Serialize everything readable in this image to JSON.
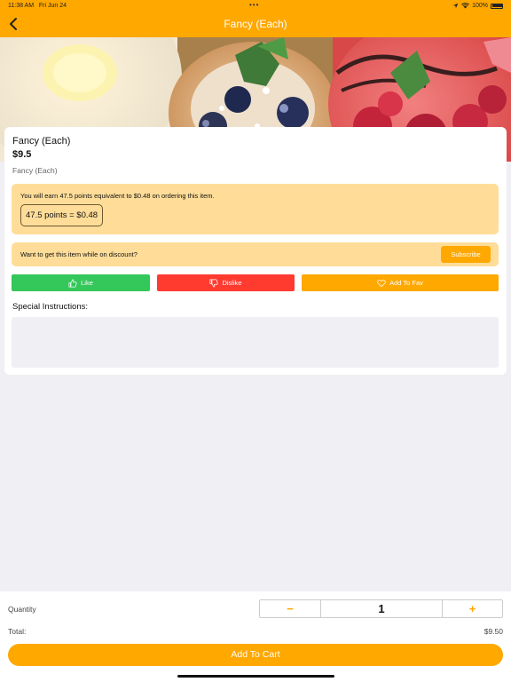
{
  "status_bar": {
    "time": "11:38 AM",
    "date": "Fri Jun 24",
    "battery": "100%"
  },
  "nav": {
    "title": "Fancy (Each)"
  },
  "product": {
    "name": "Fancy (Each)",
    "price": "$9.5",
    "subtitle": "Fancy (Each)"
  },
  "points": {
    "message": "You will earn 47.5 points equivalent to $0.48 on ordering this item.",
    "badge": "47.5 points = $0.48"
  },
  "discount": {
    "message": "Want to get this item while on discount?",
    "subscribe_label": "Subscribe"
  },
  "actions": {
    "like": "Like",
    "dislike": "Dislike",
    "fav": "Add To Fav"
  },
  "instructions": {
    "label": "Special Instructions:",
    "value": ""
  },
  "order": {
    "quantity_label": "Quantity",
    "minus": "−",
    "quantity": "1",
    "plus": "+",
    "total_label": "Total:",
    "total_value": "$9.50",
    "add_to_cart": "Add To Cart"
  },
  "colors": {
    "accent": "#ffa800",
    "like": "#34c759",
    "dislike": "#ff3b30",
    "info_bg": "#ffdd99"
  }
}
